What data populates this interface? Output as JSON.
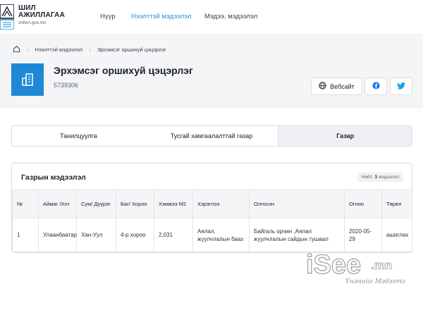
{
  "brand": {
    "line1": "ШИЛ",
    "line2": "АЖИЛЛАГАА",
    "url": "shilen.gov.mn"
  },
  "nav": {
    "items": [
      "Нүүр",
      "Нээлттэй мэдээлэл",
      "Мэдээ, мэдээлэл"
    ],
    "active_index": 1
  },
  "breadcrumb": {
    "items": [
      "Нээлттэй мэдээлэл",
      "Эрхэмсэг оршихуй цэцэрлэг"
    ]
  },
  "organization": {
    "title": "Эрхэмсэг оршихуй цэцэрлэг",
    "code": "5739306"
  },
  "actions": {
    "website_label": "Вебсайт",
    "facebook_icon": "facebook-icon",
    "twitter_icon": "twitter-icon"
  },
  "tabs": {
    "items": [
      "Танилцуулга",
      "Тусгай хамгаалалттай газар",
      "Газар"
    ],
    "active_index": 2
  },
  "land_info": {
    "title": "Газрын мэдээлэл",
    "count_prefix": "Нийт:",
    "count_value": "1",
    "count_suffix": "мэдээлэл",
    "columns": [
      "№",
      "Аймаг /Хот",
      "Сум/ Дүүрэг",
      "Баг/ Хороо",
      "Хэмжээ М2",
      "Хэрэглээ",
      "Олгосон",
      "Огноо",
      "Төрөл"
    ],
    "rows": [
      {
        "no": "1",
        "aimag": "Улаанбаатар",
        "sum": "Хан-Уул",
        "bag": "4-р хороо",
        "size": "2,031",
        "usage": "Аялал, жуулчлалын бааз",
        "granted": "Байгаль орчин ,Аялал жуулчлалын сайдын тушаал",
        "date": "2020-05-29",
        "type": "ашиглах"
      }
    ]
  },
  "watermark": {
    "text": "iSee.mn",
    "tagline": "Үнэнийг Мэдэгтэ"
  },
  "colors": {
    "accent": "#1e88d6",
    "nav_active": "#2a8fd6",
    "header_bg": "#f4f5f7",
    "facebook": "#1877f2",
    "twitter": "#1da1f2"
  }
}
